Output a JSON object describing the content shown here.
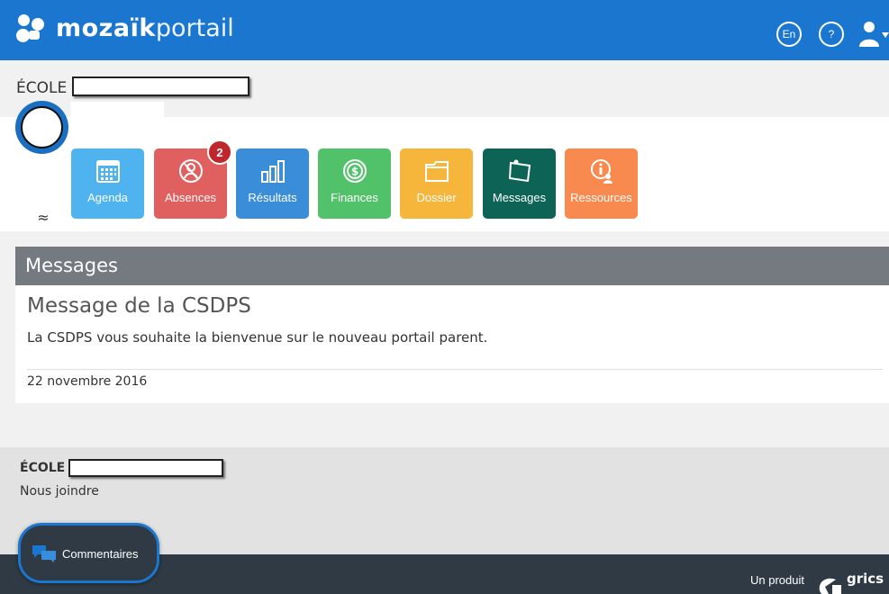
{
  "header": {
    "brand_bold": "mozaïk",
    "brand_light": "portail",
    "lang_button": "En",
    "help_button": "?",
    "color": "#1b76cf"
  },
  "school": {
    "label": "ÉCOLE"
  },
  "tiles": [
    {
      "label": "Agenda",
      "icon": "calendar-icon",
      "color": "#4fb3ef"
    },
    {
      "label": "Absences",
      "icon": "person-icon",
      "color": "#e06060"
    },
    {
      "label": "Résultats",
      "icon": "bar-chart-icon",
      "color": "#3a8dd8"
    },
    {
      "label": "Finances",
      "icon": "dollar-icon",
      "color": "#52c26a"
    },
    {
      "label": "Dossier",
      "icon": "folder-icon",
      "color": "#f6b53b"
    },
    {
      "label": "Messages",
      "icon": "note-icon",
      "color": "#0d6356"
    },
    {
      "label": "Ressources",
      "icon": "info-person-icon",
      "color": "#f98a4f"
    }
  ],
  "absences_badge": "2",
  "messages": {
    "header": "Messages",
    "title": "Message de la CSDPS",
    "body": "La CSDPS vous souhaite la bienvenue sur le nouveau portail parent.",
    "date": "22 novembre 2016"
  },
  "footer": {
    "school_label": "ÉCOLE",
    "contact": "Nous joindre",
    "product": "Un produit",
    "company": "grics",
    "feedback": "Commentaires"
  }
}
